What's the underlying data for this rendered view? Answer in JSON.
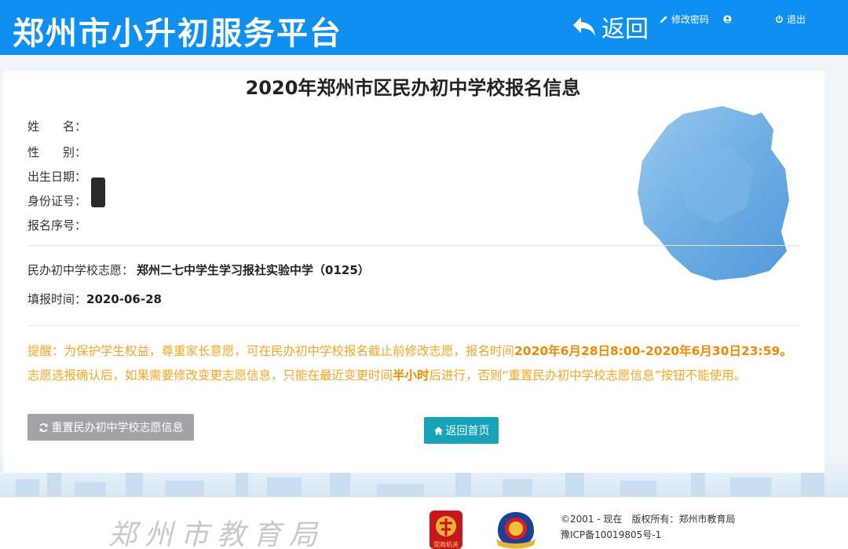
{
  "header": {
    "logo": "郑州市小升初服务平台",
    "back_label": "返回",
    "change_password": "修改密码",
    "logout": "退出"
  },
  "page": {
    "title": "2020年郑州市区民办初中学校报名信息"
  },
  "info": {
    "name_label": "姓　　名：",
    "gender_label": "性　　别：",
    "birth_label": "出生日期：",
    "id_label": "身份证号：",
    "serial_label": "报名序号："
  },
  "application": {
    "choice_label": "民办初中学校志愿：",
    "choice_value": "郑州二七中学生学习报社实验中学（0125）",
    "time_label": "填报时间：",
    "time_value": "2020-06-28"
  },
  "notice": {
    "part1": "提醒：为保护学生权益，尊重家长意愿，可在民办初中学校报名截止前修改志愿，报名时间",
    "period": "2020年6月28日8:00-2020年6月30日23:59。",
    "part2": "志愿选报确认后，如果需要修改变更志愿信息，只能在最近变更时间",
    "half_hour": "半小时",
    "part3": "后进行，否则“重置民办初中学校志愿信息”按钮不能使用。"
  },
  "buttons": {
    "reset": "重置民办初中学校志愿信息",
    "home": "返回首页"
  },
  "footer": {
    "bureau_logo_text": "郑州市教育局",
    "copyright": "©2001 - 现在　版权所有：郑州市教育局",
    "icp": "豫ICP备10019805号-1",
    "badge_text": "党政机关"
  },
  "colors": {
    "header_bg": "#0f8ff0",
    "notice": "#f5a623",
    "reset_button": "#a0a4a8",
    "home_button": "#17a2b8"
  }
}
